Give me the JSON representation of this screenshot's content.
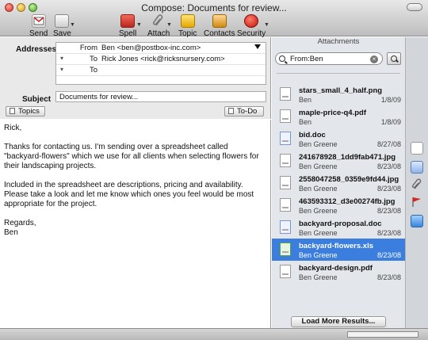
{
  "window": {
    "title": "Compose: Documents for review..."
  },
  "toolbar": {
    "send_label": "Send",
    "save_label": "Save",
    "spell_label": "Spell",
    "attach_label": "Attach",
    "topic_label": "Topic",
    "contacts_label": "Contacts",
    "security_label": "Security"
  },
  "header": {
    "addresses_label": "Addresses",
    "from_kind": "From",
    "from_value": "Ben <ben@postbox-inc.com>",
    "to_kind": "To",
    "to_value": "Rick Jones <rick@ricksnursery.com>",
    "to2_kind": "To",
    "to2_value": "",
    "subject_label": "Subject",
    "subject_value": "Documents for review...",
    "topics_label": "Topics",
    "todo_label": "To-Do"
  },
  "body": {
    "greeting": "Rick,",
    "p1": "Thanks for contacting us.  I'm sending over a spreadsheet called \"backyard-flowers\" which we use for all clients when selecting flowers for their landscaping projects.",
    "p2": "Included in the spreadsheet are descriptions, pricing and availability.  Please take a look and let me know which ones you feel would be most appropriate for the project.",
    "closing": "Regards,",
    "signature": "Ben"
  },
  "attachments_pane": {
    "title": "Attachments",
    "search_value": "From:Ben",
    "load_more_label": "Load More Results...",
    "items": [
      {
        "name": "stars_small_4_half.png",
        "from": "Ben",
        "date": "1/8/09",
        "type": "image"
      },
      {
        "name": "maple-price-q4.pdf",
        "from": "Ben",
        "date": "1/8/09",
        "type": "pdf"
      },
      {
        "name": "bid.doc",
        "from": "Ben Greene",
        "date": "8/27/08",
        "type": "doc"
      },
      {
        "name": "241678928_1dd9fab471.jpg",
        "from": "Ben Greene",
        "date": "8/23/08",
        "type": "image"
      },
      {
        "name": "2558047258_0359e9fd44.jpg",
        "from": "Ben Greene",
        "date": "8/23/08",
        "type": "image"
      },
      {
        "name": "463593312_d3e00274fb.jpg",
        "from": "Ben Greene",
        "date": "8/23/08",
        "type": "image"
      },
      {
        "name": "backyard-proposal.doc",
        "from": "Ben Greene",
        "date": "8/23/08",
        "type": "doc"
      },
      {
        "name": "backyard-flowers.xls",
        "from": "Ben Greene",
        "date": "8/23/08",
        "type": "xls",
        "selected": true
      },
      {
        "name": "backyard-design.pdf",
        "from": "Ben Greene",
        "date": "8/23/08",
        "type": "pdf"
      }
    ]
  },
  "side_strip_icons": [
    "documents-icon",
    "copy-icon",
    "paperclip-icon",
    "flag-icon",
    "address-card-icon"
  ]
}
